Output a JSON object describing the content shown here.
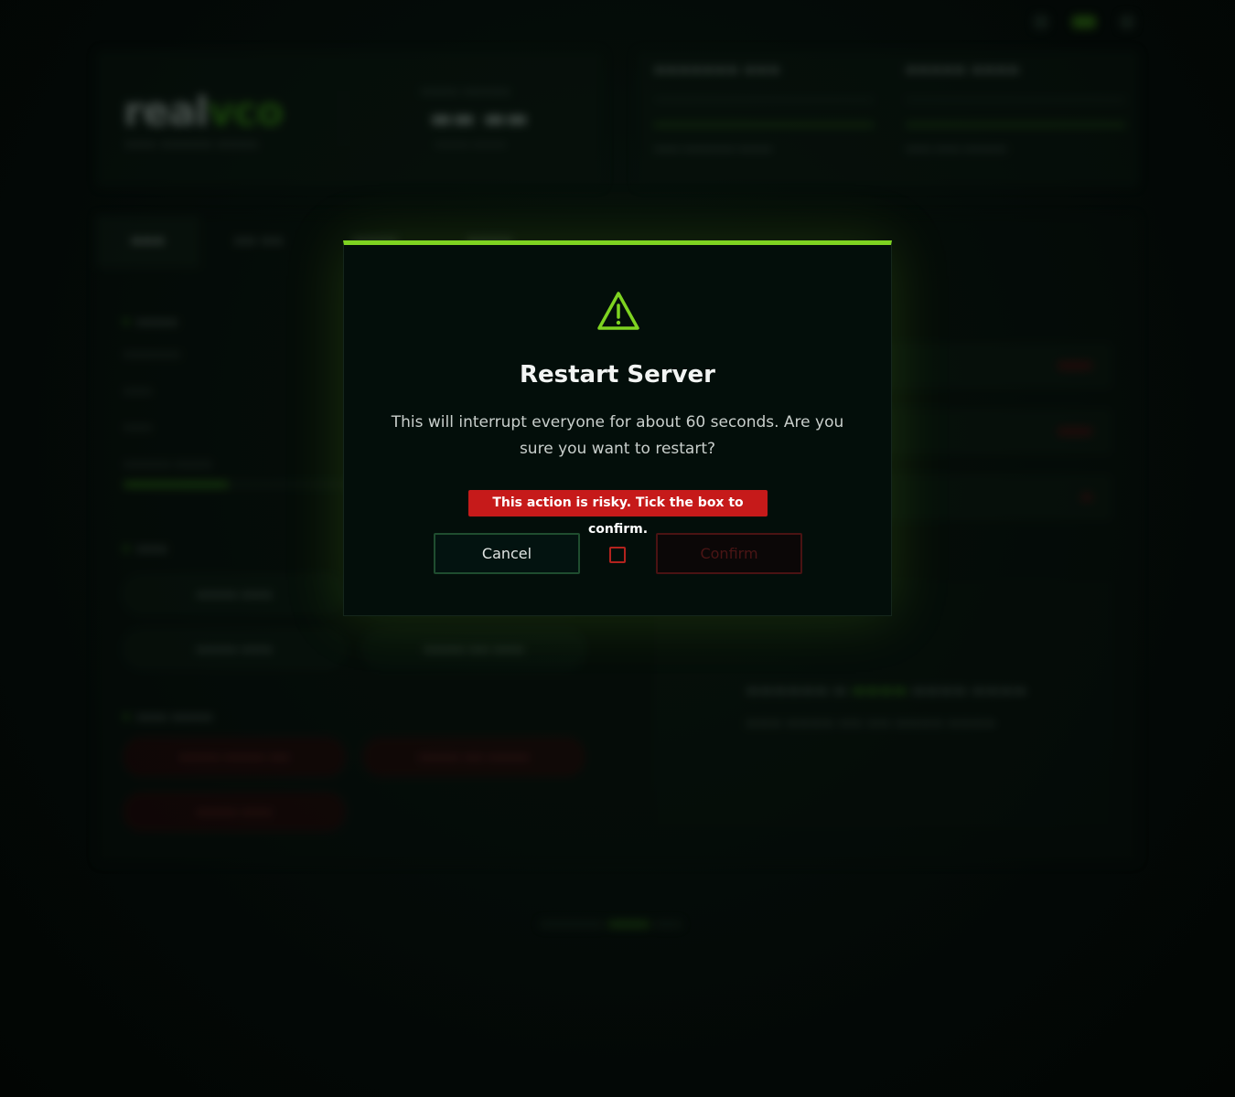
{
  "modal": {
    "title": "Restart Server",
    "message": "This will interrupt everyone for about 60 seconds. Are you sure you want to restart?",
    "risk_note": "This action is risky. Tick the box to confirm.",
    "cancel_label": "Cancel",
    "confirm_label": "Confirm",
    "checkbox_checked": false,
    "icon": "warning-triangle-icon"
  },
  "colors": {
    "accent": "#7ed321",
    "danger": "#c61a1a",
    "modal_background": "#030e0a",
    "page_background": "#040a07"
  }
}
